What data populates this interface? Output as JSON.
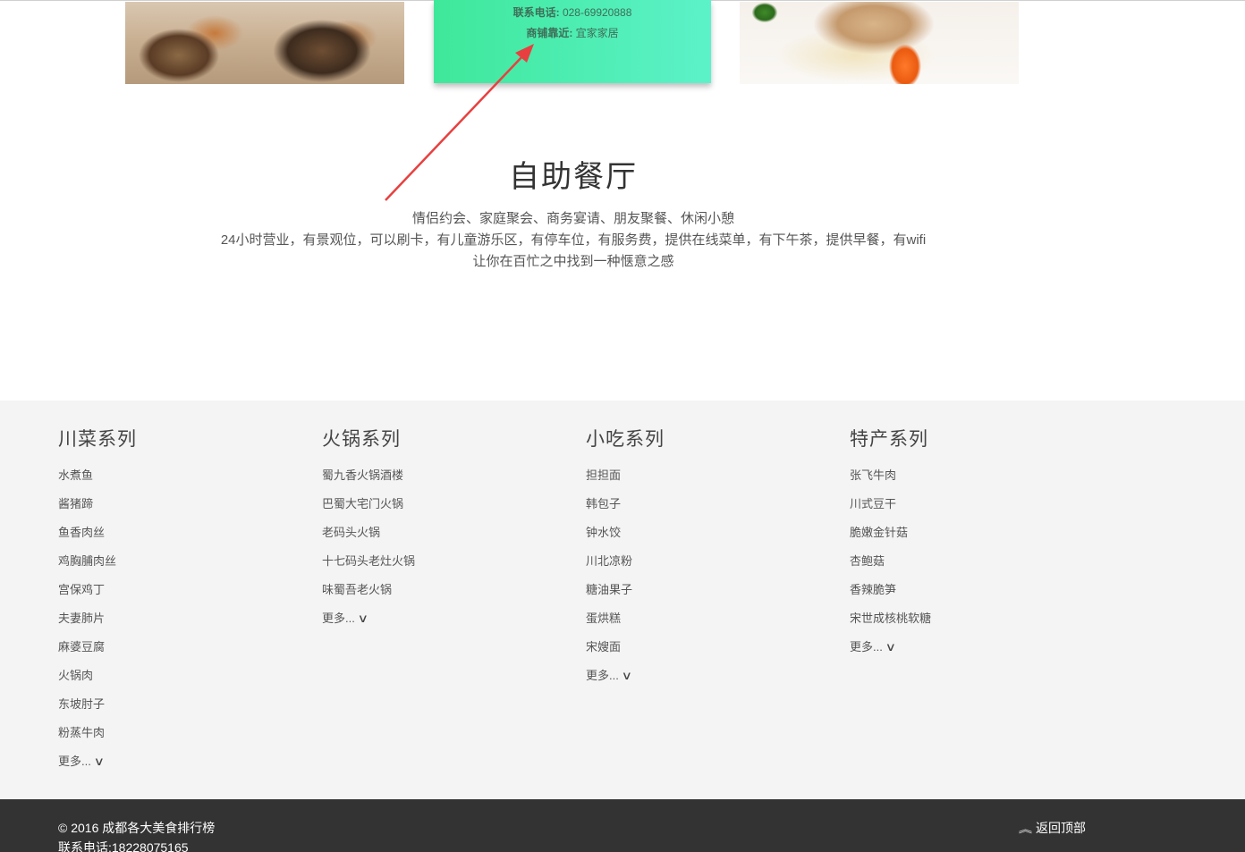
{
  "cards": {
    "phone_label": "联系电话:",
    "phone_value": "028-69920888",
    "nearby_label": "商铺靠近:",
    "nearby_value": "宜家家居"
  },
  "section": {
    "title": "自助餐厅",
    "line1": "情侣约会、家庭聚会、商务宴请、朋友聚餐、休闲小憩",
    "line2": "24小时营业，有景观位，可以刷卡，有儿童游乐区，有停车位，有服务费，提供在线菜单，有下午茶，提供早餐，有wifi",
    "line3": "让你在百忙之中找到一种惬意之感"
  },
  "annotation_color": "#e84040",
  "columns": [
    {
      "title": "川菜系列",
      "items": [
        "水煮鱼",
        "酱猪蹄",
        "鱼香肉丝",
        "鸡胸脯肉丝",
        "宫保鸡丁",
        "夫妻肺片",
        "麻婆豆腐",
        "火锅肉",
        "东坡肘子",
        "粉蒸牛肉"
      ],
      "more": "更多...",
      "more_icon": "∨"
    },
    {
      "title": "火锅系列",
      "items": [
        "蜀九香火锅酒楼",
        "巴蜀大宅门火锅",
        "老码头火锅",
        "十七码头老灶火锅",
        "味蜀吾老火锅"
      ],
      "more": "更多...",
      "more_icon": "∨"
    },
    {
      "title": "小吃系列",
      "items": [
        "担担面",
        "韩包子",
        "钟水饺",
        "川北凉粉",
        "糖油果子",
        "蛋烘糕",
        "宋嫂面"
      ],
      "more": "更多...",
      "more_icon": "∨"
    },
    {
      "title": "特产系列",
      "items": [
        "张飞牛肉",
        "川式豆干",
        "脆嫩金针菇",
        "杏鲍菇",
        "香辣脆笋",
        "宋世成核桃软糖"
      ],
      "more": "更多...",
      "more_icon": "∨"
    }
  ],
  "footer": {
    "copyright": "© 2016 成都各大美食排行榜",
    "phone": "联系电话:18228075165",
    "back_to_top": "返回顶部",
    "back_icon": "︽"
  }
}
